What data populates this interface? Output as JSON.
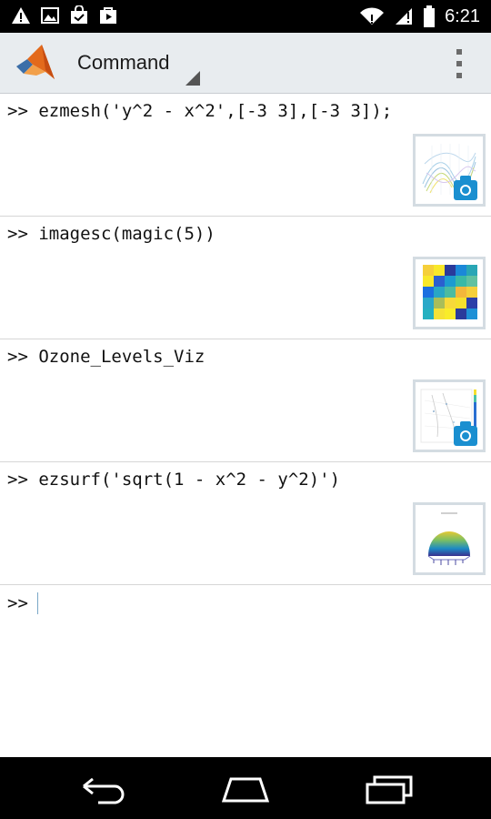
{
  "status_bar": {
    "time": "6:21",
    "icons_left": [
      "warning-icon",
      "image-icon",
      "shopping-bag-icon",
      "play-store-icon"
    ],
    "icons_right": [
      "wifi-icon",
      "signal-icon",
      "battery-icon"
    ]
  },
  "action_bar": {
    "title": "Command",
    "overflow_icon": "overflow-menu-icon"
  },
  "entries": [
    {
      "command": ">> ezmesh('y^2 - x^2',[-3 3],[-3 3]);",
      "has_camera": true
    },
    {
      "command": ">> imagesc(magic(5))",
      "has_camera": false
    },
    {
      "command": ">> Ozone_Levels_Viz",
      "has_camera": true
    },
    {
      "command": ">> ezsurf('sqrt(1 - x^2 - y^2)')",
      "has_camera": false
    }
  ],
  "prompt": ">>",
  "nav": [
    "back-icon",
    "home-icon",
    "recents-icon"
  ]
}
